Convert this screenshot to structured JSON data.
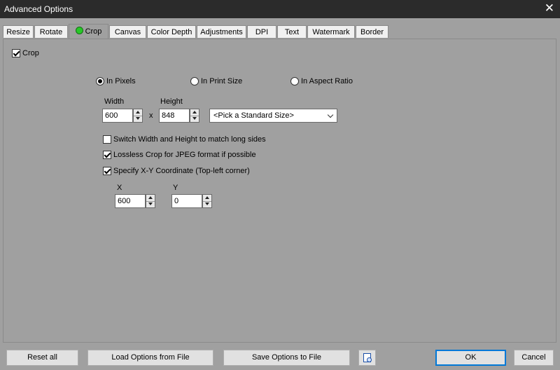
{
  "window": {
    "title": "Advanced Options"
  },
  "tabs": [
    {
      "label": "Resize"
    },
    {
      "label": "Rotate"
    },
    {
      "label": "Crop",
      "active": true
    },
    {
      "label": "Canvas"
    },
    {
      "label": "Color Depth"
    },
    {
      "label": "Adjustments"
    },
    {
      "label": "DPI"
    },
    {
      "label": "Text"
    },
    {
      "label": "Watermark"
    },
    {
      "label": "Border"
    }
  ],
  "crop": {
    "enable_label": "Crop",
    "enable_checked": true,
    "mode": {
      "pixels": "In Pixels",
      "print": "In Print Size",
      "aspect": "In Aspect Ratio",
      "selected": "pixels"
    },
    "width_label": "Width",
    "height_label": "Height",
    "width_value": "600",
    "height_value": "848",
    "times": "x",
    "standard_size": "<Pick a Standard Size>",
    "switch_label": "Switch Width and Height to match long sides",
    "switch_checked": false,
    "lossless_label": "Lossless Crop for JPEG format if possible",
    "lossless_checked": true,
    "xy_label": "Specify X-Y Coordinate (Top-left corner)",
    "xy_checked": true,
    "x_label": "X",
    "y_label": "Y",
    "x_value": "600",
    "y_value": "0"
  },
  "footer": {
    "reset": "Reset all",
    "load": "Load Options from File",
    "save": "Save Options to File",
    "ok": "OK",
    "cancel": "Cancel"
  },
  "colors": {
    "accent_green": "#28c828",
    "focus_blue": "#0078d7",
    "background": "#a0a0a0"
  }
}
